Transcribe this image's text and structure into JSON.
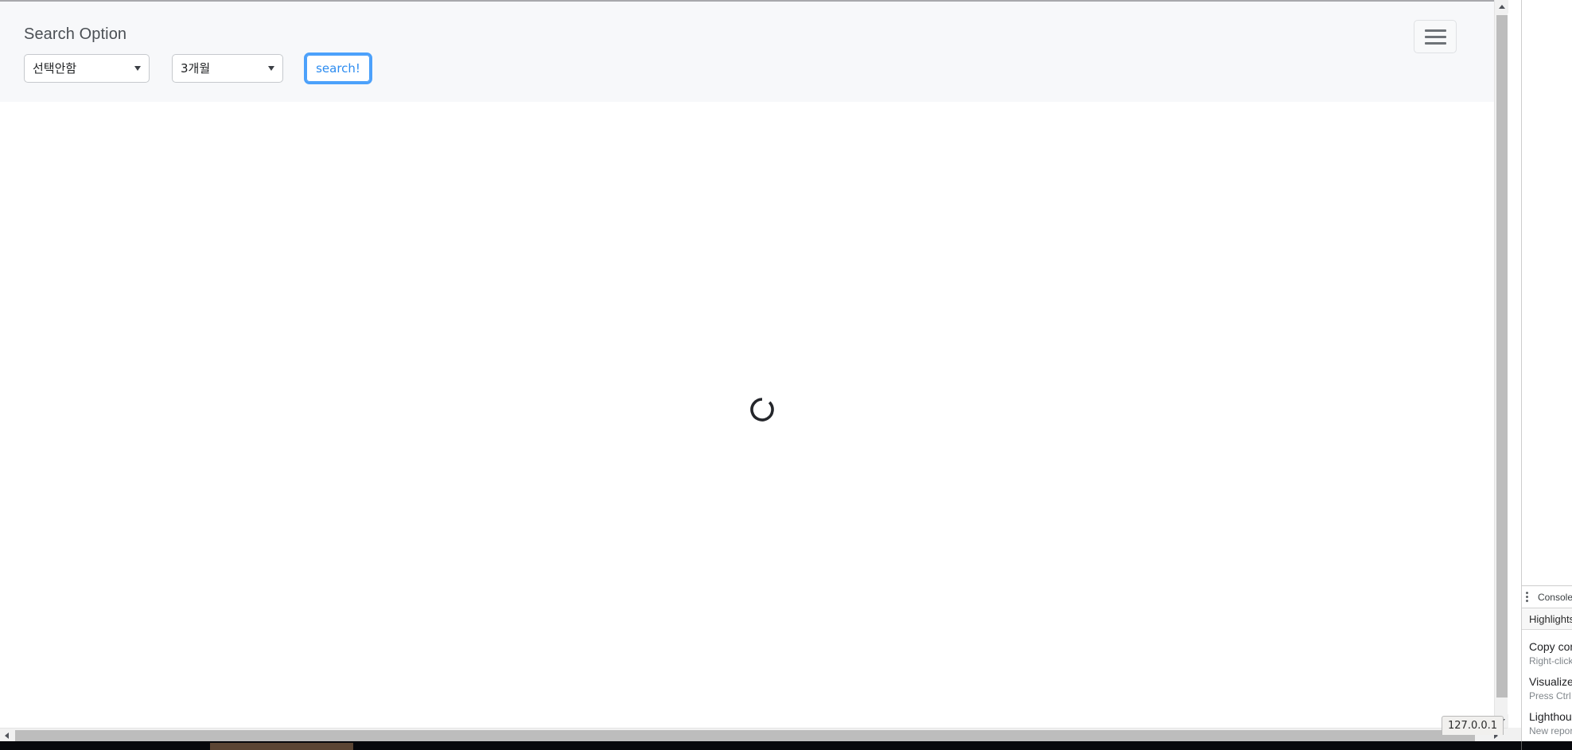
{
  "page": {
    "title": "Search Option"
  },
  "header": {
    "title": "Search Option",
    "category_select": {
      "name": "category-select",
      "value": "선택안함",
      "options": [
        "선택안함"
      ]
    },
    "period_select": {
      "name": "period-select",
      "value": "3개월",
      "options": [
        "3개월"
      ]
    },
    "search_button": {
      "label": "search!"
    },
    "menu_button": {
      "icon": "hamburger-menu-icon"
    }
  },
  "main": {
    "loading_spinner": {
      "icon": "loading-spinner-icon",
      "color": "#24262b",
      "visible": true
    }
  },
  "status_bar": {
    "url_hint": "127.0.0.1"
  },
  "scrollbars": {
    "vertical": {
      "up_arrow_icon": "triangle-up-icon",
      "down_arrow_icon": "triangle-down-icon"
    },
    "horizontal": {
      "left_arrow_icon": "triangle-left-icon",
      "right_arrow_icon": "triangle-right-icon"
    }
  },
  "devtools": {
    "tabbar": {
      "more_icon": "kebab-menu-icon",
      "active_tab": "Console"
    },
    "subbar": {
      "label": "Highlights"
    },
    "whats_new_items": [
      {
        "title": "Copy commands",
        "desc": "Right-click an element"
      },
      {
        "title": "Visualize layout shifts",
        "desc": "Press Ctrl to see layout shifts."
      },
      {
        "title": "Lighthouse",
        "desc": "New report"
      }
    ]
  },
  "colors": {
    "header_bg": "#f7f8fa",
    "accent_blue": "#2d8cf0",
    "focus_ring": "#4ca1fb",
    "text_muted": "#80868b",
    "scrollbar_thumb": "#bdbdbd"
  }
}
